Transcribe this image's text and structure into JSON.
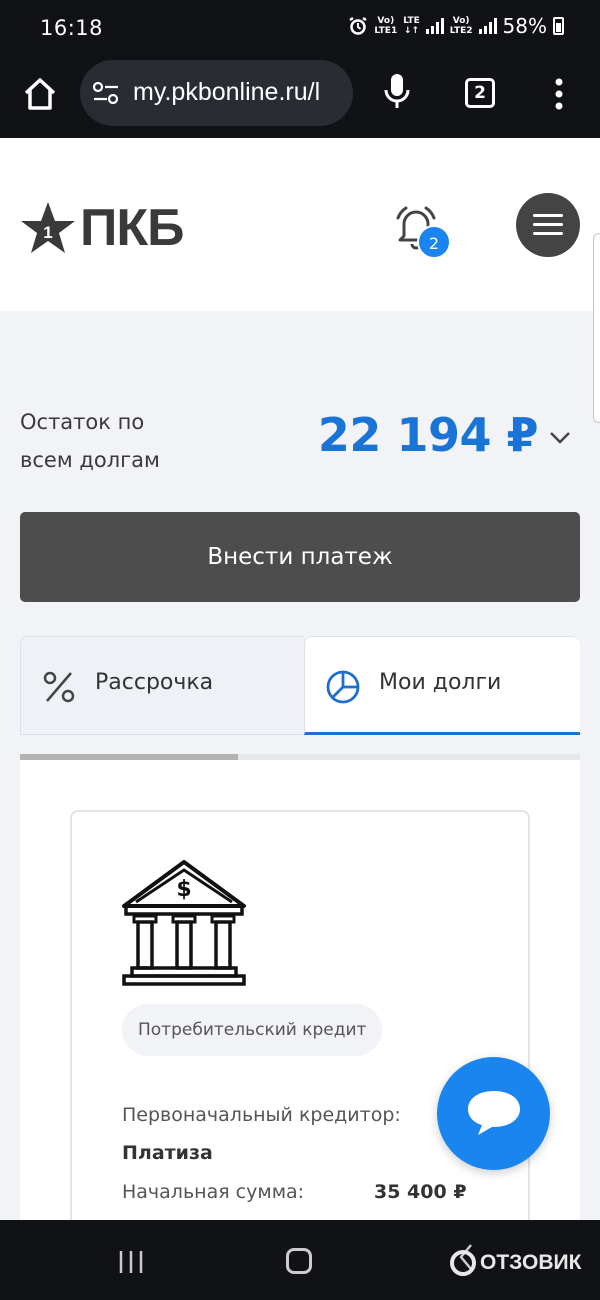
{
  "status_bar": {
    "time": "16:18",
    "battery": "58%",
    "net1_top": "Vo)",
    "net1_bottom": "LTE1",
    "lte_top": "LTE",
    "lte_bottom": "↓↑",
    "net2_top": "Vo)",
    "net2_bottom": "LTE2",
    "icons": [
      "alarm-icon",
      "signal-icon",
      "battery-icon"
    ]
  },
  "browser": {
    "url": "my.pkbonline.ru/l",
    "tab_count": "2",
    "icons": [
      "home-icon",
      "tune-icon",
      "mic-icon",
      "more-vert-icon"
    ]
  },
  "site": {
    "logo_text": "ПКБ",
    "logo_star_number": "1",
    "notification_count": "2",
    "icons": [
      "star-logo-icon",
      "bell-icon",
      "hamburger-icon"
    ]
  },
  "debt": {
    "label_line1": "Остаток по",
    "label_line2": "всем долгам",
    "amount": "22 194 ₽",
    "accent_color": "#1a74d6"
  },
  "actions": {
    "pay_button": "Внести платеж"
  },
  "tabs": [
    {
      "label": "Рассрочка",
      "icon": "percent-icon",
      "active": false
    },
    {
      "label": "Мои долги",
      "icon": "pie-chart-icon",
      "active": true
    }
  ],
  "carousel_progress": 0.39,
  "loan_card": {
    "icon": "bank-building-icon",
    "type_chip": "Потребительский кредит",
    "creditor_label": "Первоначальный кредитор:",
    "creditor_value": "Платиза",
    "sum_label": "Начальная сумма:",
    "sum_value": "35 400 ₽"
  },
  "chat": {
    "icon": "chat-bubble-icon",
    "color": "#1a85ee"
  },
  "nav_bar": {
    "icons": [
      "recent-apps-icon",
      "home-nav-icon",
      "back-icon"
    ],
    "watermark": "ОТЗОВИК"
  }
}
